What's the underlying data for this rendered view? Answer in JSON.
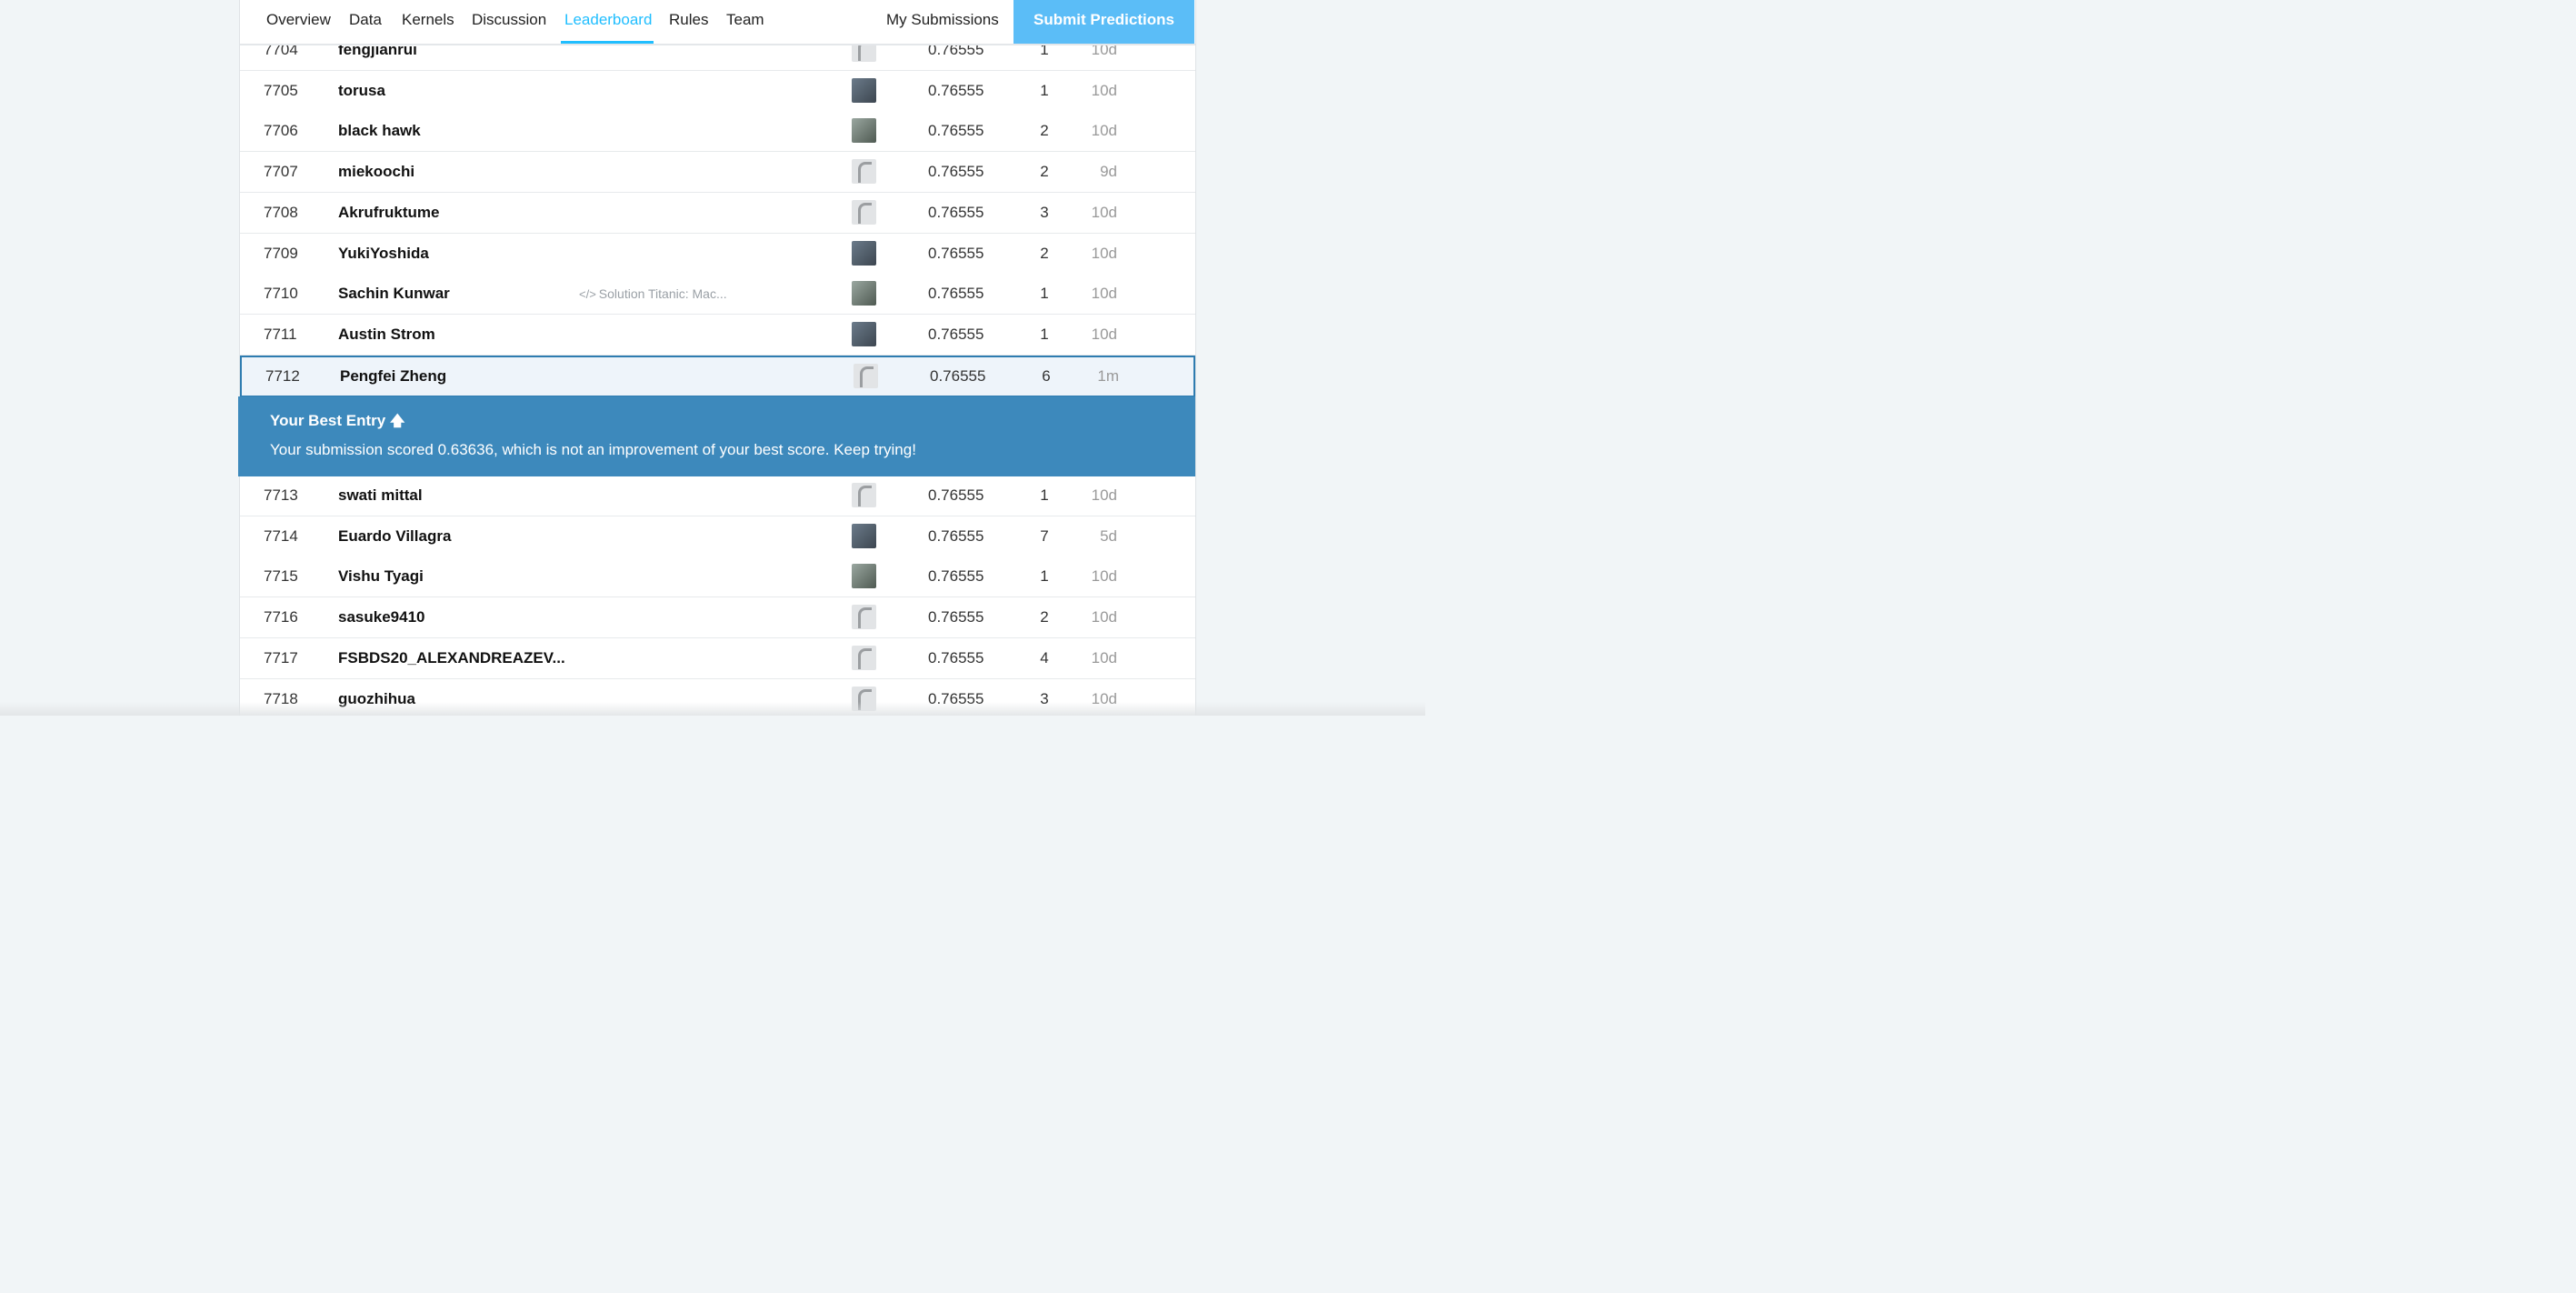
{
  "nav": {
    "tabs": [
      "Overview",
      "Data",
      "Kernels",
      "Discussion",
      "Leaderboard",
      "Rules",
      "Team"
    ],
    "active_tab": "Leaderboard",
    "my_submissions": "My Submissions",
    "submit": "Submit Predictions"
  },
  "colors": {
    "accent": "#20beff",
    "banner": "#3d89bc",
    "highlight_border": "#2e7cb0",
    "submit_bg": "#5bbdf7"
  },
  "rows_top": [
    {
      "rank": "7704",
      "name": "fengjianrui",
      "kernel": "",
      "score": "0.76555",
      "entries": "1",
      "last": "10d",
      "tier": "novice"
    },
    {
      "rank": "7705",
      "name": "torusa",
      "kernel": "",
      "score": "0.76555",
      "entries": "1",
      "last": "10d",
      "tier": "novice"
    },
    {
      "rank": "7706",
      "name": "black hawk",
      "kernel": "",
      "score": "0.76555",
      "entries": "2",
      "last": "10d",
      "tier": "contributor"
    },
    {
      "rank": "7707",
      "name": "miekoochi",
      "kernel": "",
      "score": "0.76555",
      "entries": "2",
      "last": "9d",
      "tier": "novice"
    },
    {
      "rank": "7708",
      "name": "Akrufruktume",
      "kernel": "",
      "score": "0.76555",
      "entries": "3",
      "last": "10d",
      "tier": "novice"
    },
    {
      "rank": "7709",
      "name": "YukiYoshida",
      "kernel": "",
      "score": "0.76555",
      "entries": "2",
      "last": "10d",
      "tier": "novice"
    },
    {
      "rank": "7710",
      "name": "Sachin Kunwar",
      "kernel": "Solution Titanic: Mac...",
      "score": "0.76555",
      "entries": "1",
      "last": "10d",
      "tier": "contributor"
    },
    {
      "rank": "7711",
      "name": "Austin Strom",
      "kernel": "",
      "score": "0.76555",
      "entries": "1",
      "last": "10d",
      "tier": "novice"
    }
  ],
  "my_row": {
    "rank": "7712",
    "name": "Pengfei Zheng",
    "score": "0.76555",
    "entries": "6",
    "last": "1m"
  },
  "best_entry": {
    "title": "Your Best Entry",
    "message": "Your submission scored 0.63636, which is not an improvement of your best score. Keep trying!"
  },
  "rows_bottom": [
    {
      "rank": "7713",
      "name": "swati mittal",
      "score": "0.76555",
      "entries": "1",
      "last": "10d",
      "tier": "novice"
    },
    {
      "rank": "7714",
      "name": "Euardo Villagra",
      "score": "0.76555",
      "entries": "7",
      "last": "5d",
      "tier": "contributor"
    },
    {
      "rank": "7715",
      "name": "Vishu Tyagi",
      "score": "0.76555",
      "entries": "1",
      "last": "10d",
      "tier": "novice"
    },
    {
      "rank": "7716",
      "name": "sasuke9410",
      "score": "0.76555",
      "entries": "2",
      "last": "10d",
      "tier": "novice"
    },
    {
      "rank": "7717",
      "name": "FSBDS20_ALEXANDREAZEV...",
      "score": "0.76555",
      "entries": "4",
      "last": "10d",
      "tier": "novice"
    },
    {
      "rank": "7718",
      "name": "guozhihua",
      "score": "0.76555",
      "entries": "3",
      "last": "10d",
      "tier": "novice"
    }
  ]
}
